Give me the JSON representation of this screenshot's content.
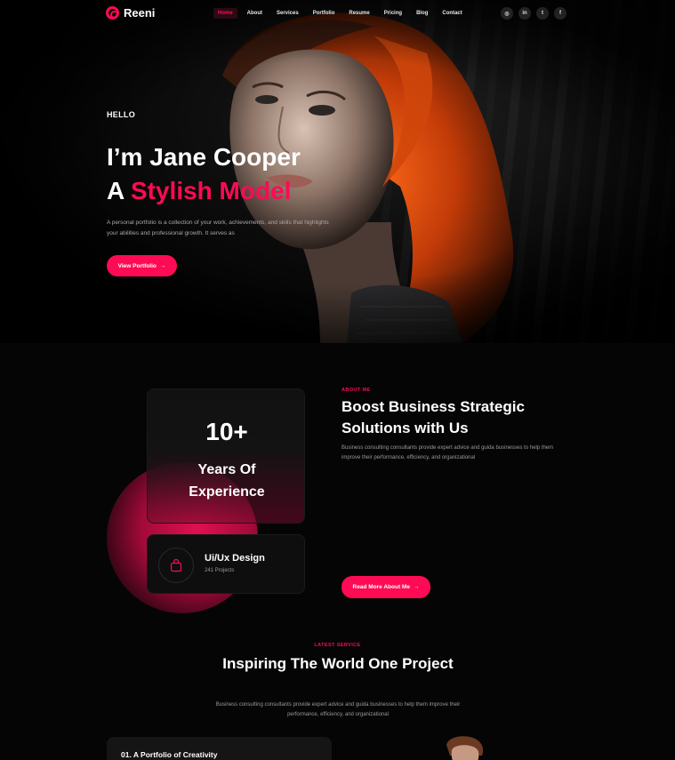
{
  "brand": {
    "name": "Reeni",
    "accent": "#ff0a54"
  },
  "nav": {
    "items": [
      {
        "label": "Home",
        "active": true
      },
      {
        "label": "About",
        "active": false
      },
      {
        "label": "Services",
        "active": false
      },
      {
        "label": "Portfolio",
        "active": false
      },
      {
        "label": "Resume",
        "active": false
      },
      {
        "label": "Pricing",
        "active": false
      },
      {
        "label": "Blog",
        "active": false
      },
      {
        "label": "Contact",
        "active": false
      }
    ],
    "socials": [
      {
        "icon": "instagram-icon",
        "glyph": "◎"
      },
      {
        "icon": "linkedin-icon",
        "glyph": "in"
      },
      {
        "icon": "twitter-icon",
        "glyph": "t"
      },
      {
        "icon": "facebook-icon",
        "glyph": "f"
      }
    ]
  },
  "hero": {
    "eyebrow": "HELLO",
    "title_line1": "I’m Jane Cooper",
    "title_prefix": "A ",
    "title_accent": "Stylish Model",
    "description": "A personal portfolio is a collection of your work, achievements, and skills that highlights your abilities and professional growth. It serves as",
    "button_label": "View Portfolio",
    "button_icon": "arrow-right-icon"
  },
  "about": {
    "experience_value": "10+",
    "experience_label_1": "Years Of",
    "experience_label_2": "Experience",
    "skill_title": "Ui/Ux Design",
    "skill_sub": "241 Projects",
    "skill_icon": "bag-icon",
    "tag": "ABOUT ME",
    "title": "Boost Business Strategic Solutions with Us",
    "description": "Business consulting consultants provide expert advice and guida businesses to help them improve their performance, efficiency, and organizational",
    "button_label": "Read More About Me"
  },
  "services": {
    "tag": "LATEST SERVICE",
    "title": "Inspiring The World One Project",
    "description": "Business consulting consultants provide expert advice and guida businesses to help them improve their performance, efficiency, and organizational",
    "first_item": "01.  A Portfolio of Creativity"
  }
}
